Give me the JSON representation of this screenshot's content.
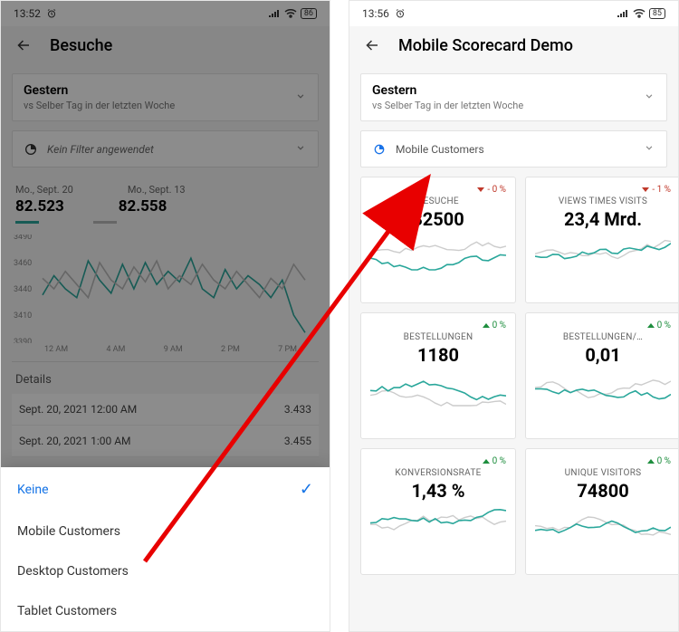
{
  "left": {
    "status": {
      "time": "13:52",
      "battery": "86"
    },
    "title": "Besuche",
    "date": {
      "main": "Gestern",
      "sub": "vs Selber Tag in der letzten Woche"
    },
    "filter": {
      "label": "Kein Filter angewendet"
    },
    "series": {
      "d1_label": "Mo., Sept. 20",
      "d1_val": "82.523",
      "d2_label": "Mo., Sept. 13",
      "d2_val": "82.558"
    },
    "yticks": [
      "3490",
      "3460",
      "3440",
      "3410",
      "3390"
    ],
    "xticks": [
      "12 AM",
      "4 AM",
      "9 AM",
      "2 PM",
      "7 PM"
    ],
    "details_label": "Details",
    "detail_rows": [
      {
        "t": "Sept. 20, 2021 12:00 AM",
        "v": "3.433"
      },
      {
        "t": "Sept. 20, 2021 1:00 AM",
        "v": "3.455"
      }
    ],
    "sheet": {
      "items": [
        {
          "label": "Keine",
          "selected": true
        },
        {
          "label": "Mobile Customers",
          "selected": false
        },
        {
          "label": "Desktop Customers",
          "selected": false
        },
        {
          "label": "Tablet Customers",
          "selected": false
        }
      ]
    }
  },
  "right": {
    "status": {
      "time": "13:56",
      "battery": "85"
    },
    "title": "Mobile Scorecard Demo",
    "date": {
      "main": "Gestern",
      "sub": "vs Selber Tag in der letzten Woche"
    },
    "filter": {
      "applied": "Mobile Customers"
    },
    "tiles": [
      {
        "delta": "- 0 %",
        "dir": "down",
        "title": "BESUCHE",
        "val": "82500"
      },
      {
        "delta": "- 1 %",
        "dir": "down",
        "title": "VIEWS TIMES VISITS",
        "val": "23,4 Mrd."
      },
      {
        "delta": "0 %",
        "dir": "up",
        "title": "BESTELLUNGEN",
        "val": "1180"
      },
      {
        "delta": "0 %",
        "dir": "up",
        "title": "BESTELLUNGEN/…",
        "val": "0,01"
      },
      {
        "delta": "0 %",
        "dir": "up",
        "title": "KONVERSIONSRATE",
        "val": "1,43 %"
      },
      {
        "delta": "0 %",
        "dir": "up",
        "title": "UNIQUE VISITORS",
        "val": "74800"
      }
    ]
  },
  "chart_data": {
    "type": "line",
    "title": "Besuche — Mo., Sept. 20 vs Mo., Sept. 13",
    "xlabel": "",
    "ylabel": "",
    "ylim": [
      3380,
      3500
    ],
    "x": [
      0,
      1,
      2,
      3,
      4,
      5,
      6,
      7,
      8,
      9,
      10,
      11,
      12,
      13,
      14,
      15,
      16,
      17,
      18,
      19,
      20,
      21,
      22,
      23
    ],
    "xticks": [
      "12 AM",
      "4 AM",
      "9 AM",
      "2 PM",
      "7 PM"
    ],
    "series": [
      {
        "name": "Mo., Sept. 20",
        "color": "#2aa79b",
        "values": [
          3433,
          3455,
          3440,
          3430,
          3472,
          3450,
          3435,
          3468,
          3440,
          3470,
          3445,
          3460,
          3448,
          3475,
          3440,
          3430,
          3462,
          3440,
          3455,
          3445,
          3430,
          3450,
          3410,
          3390
        ]
      },
      {
        "name": "Mo., Sept. 13",
        "color": "#bbbbbb",
        "values": [
          3452,
          3440,
          3460,
          3445,
          3430,
          3470,
          3450,
          3440,
          3465,
          3448,
          3472,
          3440,
          3455,
          3445,
          3468,
          3450,
          3440,
          3460,
          3445,
          3430,
          3452,
          3440,
          3468,
          3450
        ]
      }
    ]
  }
}
